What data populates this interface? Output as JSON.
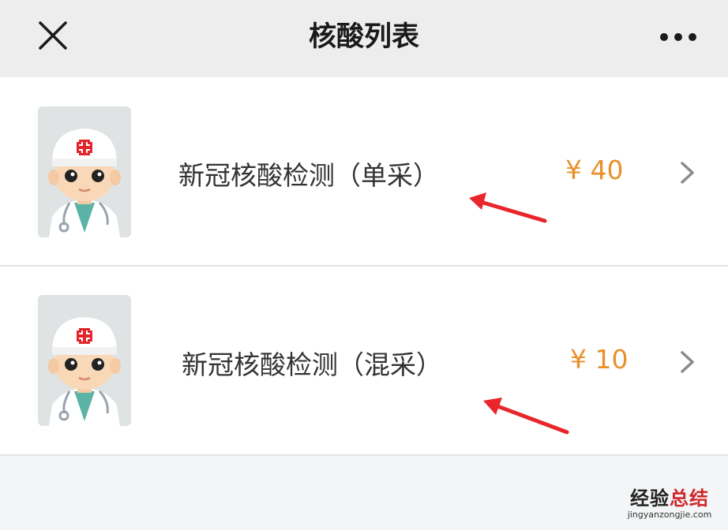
{
  "header": {
    "title": "核酸列表",
    "close_icon": "close-icon",
    "more_icon": "more-horizontal-icon"
  },
  "items": [
    {
      "name": "新冠核酸检测（单采）",
      "price": "¥ 40",
      "avatar_icon": "doctor-avatar-icon"
    },
    {
      "name": "新冠核酸检测（混采）",
      "price": "¥ 10",
      "avatar_icon": "doctor-avatar-icon"
    }
  ],
  "colors": {
    "header_bg": "#ededed",
    "price": "#e8902a",
    "annotation_arrow": "#e8262b"
  },
  "watermark": {
    "text_main_1": "经验",
    "text_main_2": "总结",
    "text_sub": "jingyanzongjie.com"
  }
}
